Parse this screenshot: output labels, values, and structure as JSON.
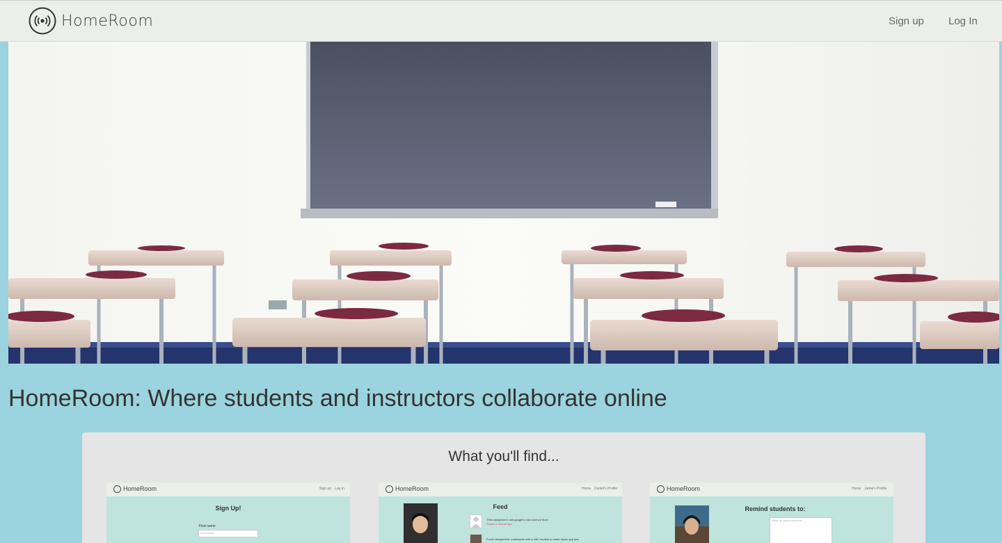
{
  "navbar": {
    "brand": "HomeRoom",
    "links": {
      "signup": "Sign up",
      "login": "Log In"
    }
  },
  "hero": {
    "image": "classroom-photo"
  },
  "headline": "HomeRoom: Where students and instructors collaborate online",
  "features": {
    "title": "What you'll find...",
    "screens": [
      {
        "brand": "HomeRoom",
        "nav": [
          "Sign up",
          "Log In"
        ],
        "title": "Sign Up!",
        "field_label": "First name",
        "field_placeholder": "First Name"
      },
      {
        "brand": "HomeRoom",
        "nav": [
          "Home",
          "Daniel's Profile"
        ],
        "title": "Feed",
        "items": [
          {
            "text": "Third assignment: ask google's robo science team",
            "sub": "Posted 1 minute ago"
          },
          {
            "text": "Fourth assignment: collaborate with a UBC student to make music app aaa"
          }
        ]
      },
      {
        "brand": "HomeRoom",
        "nav": [
          "Home",
          "Jamie's Profile"
        ],
        "title": "Remind students to:",
        "field_placeholder": "Make an announcement..."
      }
    ]
  },
  "colors": {
    "page_bg": "#9bd3de",
    "navbar_bg": "#eceee9",
    "panel_bg": "#e5e5e5",
    "screen_bg": "#bfe3dd",
    "chalkboard": "#5a6173"
  }
}
